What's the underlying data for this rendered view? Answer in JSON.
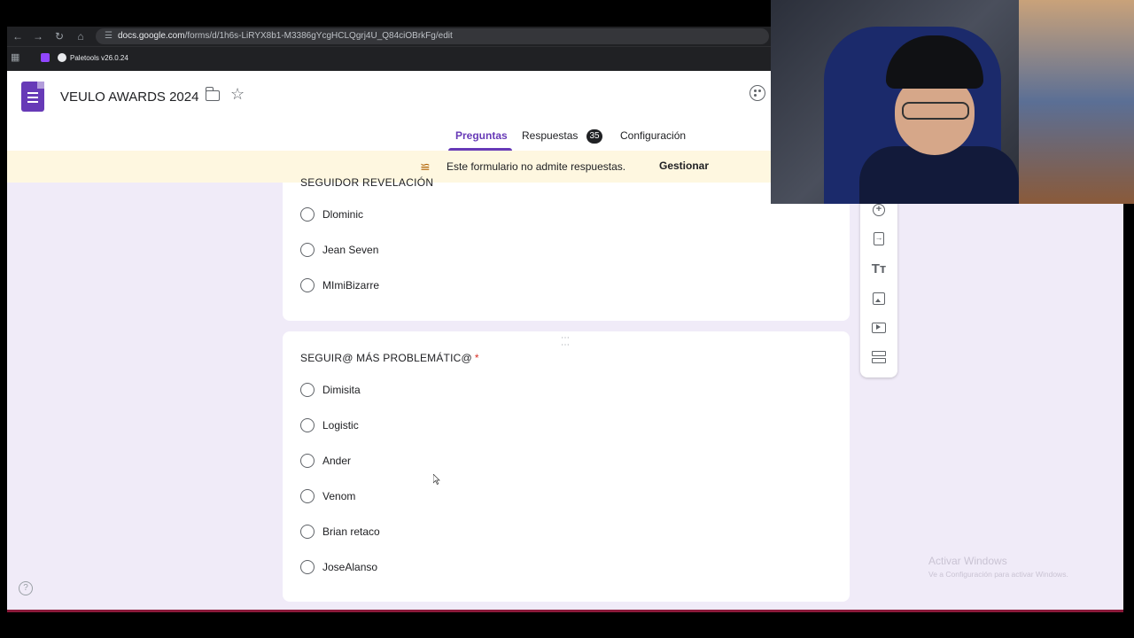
{
  "browser": {
    "url_host": "docs.google.com",
    "url_path": "/forms/d/1h6s-LiRYX8b1-M3386gYcgHCLQgrj4U_Q84ciOBrkFg/edit",
    "bookmark_label": "Paletools v26.0.24"
  },
  "header": {
    "doc_title": "VEULO AWARDS 2024"
  },
  "tabs": {
    "preguntas": "Preguntas",
    "respuestas": "Respuestas",
    "respuestas_count": "35",
    "configuracion": "Configuración"
  },
  "banner": {
    "text": "Este formulario no admite respuestas.",
    "button": "Gestionar"
  },
  "question1": {
    "title_partial": "SEGUIDOR REVELACIÓN",
    "options": [
      "Dlominic",
      "Jean Seven",
      "MImiBizarre"
    ]
  },
  "question2": {
    "title": "SEGUIR@ MÁS PROBLEMÁTIC@",
    "required_mark": "*",
    "options": [
      "Dimisita",
      "Logistic",
      "Ander",
      "Venom",
      "Brian retaco",
      "JoseAlanso"
    ]
  },
  "windows_watermark": {
    "title": "Activar Windows",
    "subtitle": "Ve a Configuración para activar Windows."
  },
  "colors": {
    "accent": "#673ab7",
    "background": "#f0ebf8",
    "banner": "#fef7e0"
  },
  "icons": [
    "back-icon",
    "forward-icon",
    "reload-icon",
    "home-icon",
    "apps-icon",
    "folder-icon",
    "star-icon",
    "palette-icon",
    "add-question-icon",
    "import-icon",
    "title-icon",
    "image-icon",
    "video-icon",
    "section-icon",
    "help-icon"
  ]
}
